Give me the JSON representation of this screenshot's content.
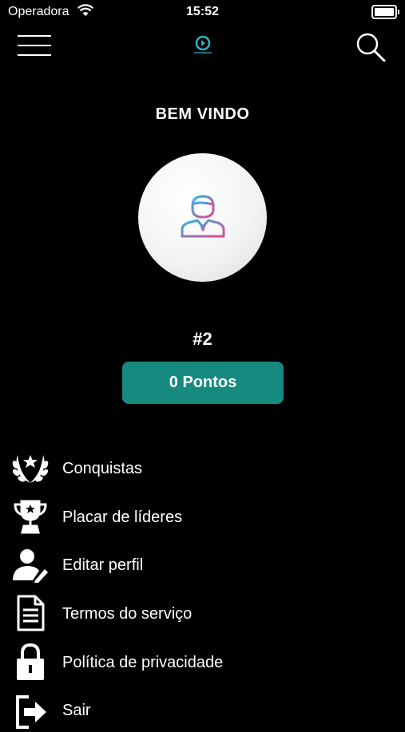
{
  "status_bar": {
    "carrier": "Operadora",
    "time": "15:52"
  },
  "header": {
    "menu_icon": "hamburger-icon",
    "logo_icon": "app-logo-icon",
    "search_icon": "search-icon"
  },
  "profile": {
    "welcome": "BEM VINDO",
    "rank": "#2",
    "points_label": "0 Pontos",
    "avatar_icon": "user-avatar-icon"
  },
  "menu": [
    {
      "label": "Conquistas",
      "icon": "laurel-wreath-icon"
    },
    {
      "label": "Placar de líderes",
      "icon": "trophy-icon"
    },
    {
      "label": "Editar perfil",
      "icon": "edit-user-icon"
    },
    {
      "label": "Termos do serviço",
      "icon": "document-icon"
    },
    {
      "label": "Política de privacidade",
      "icon": "lock-icon"
    },
    {
      "label": "Sair",
      "icon": "logout-icon"
    }
  ],
  "colors": {
    "background": "#000000",
    "accent": "#178a80"
  }
}
